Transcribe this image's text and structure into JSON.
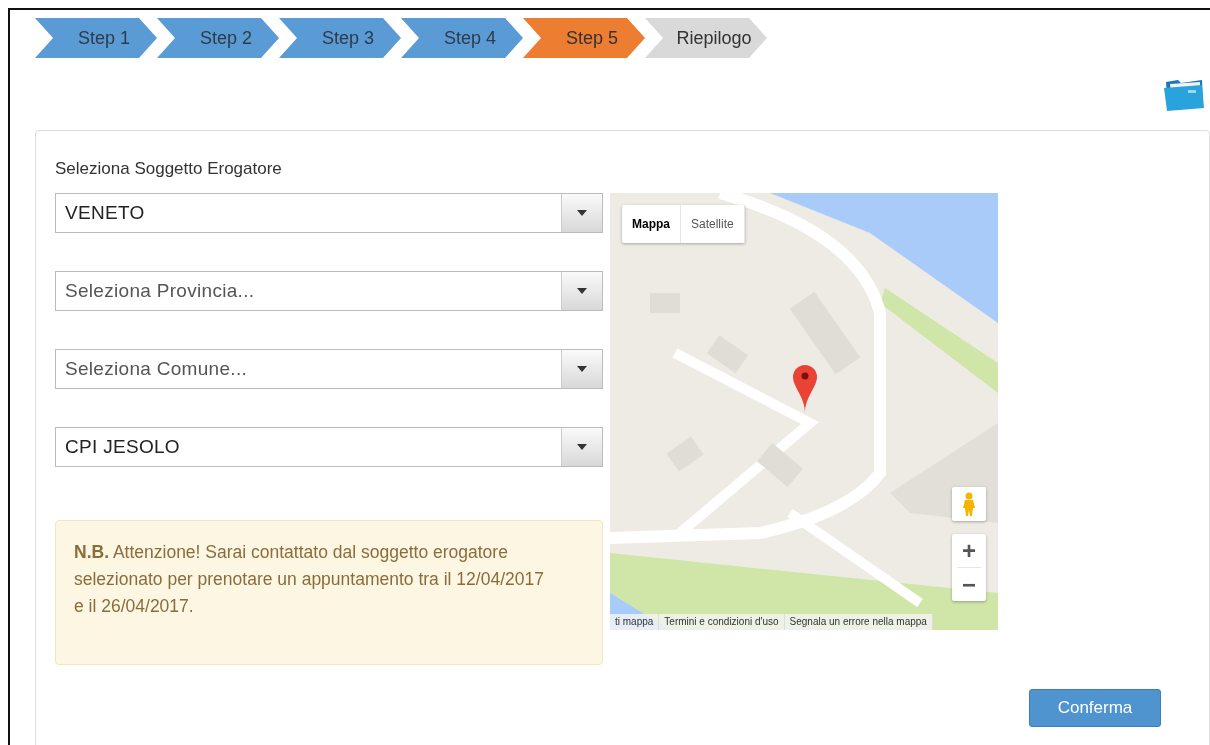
{
  "steps": [
    {
      "label": "Step 1",
      "completed": true,
      "selected": false
    },
    {
      "label": "Step 2",
      "completed": true,
      "selected": false
    },
    {
      "label": "Step 3",
      "completed": true,
      "selected": false
    },
    {
      "label": "Step 4",
      "completed": true,
      "selected": false
    },
    {
      "label": "Step 5",
      "completed": false,
      "selected": true
    },
    {
      "label": "Riepilogo",
      "completed": false,
      "selected": false
    }
  ],
  "form": {
    "title": "Seleziona Soggetto Erogatore",
    "selects": [
      {
        "value": "VENETO"
      },
      {
        "placeholder": "Seleziona Provincia..."
      },
      {
        "placeholder": "Seleziona Comune..."
      },
      {
        "value": "CPI JESOLO"
      }
    ],
    "note": "**N.B.** Attenzione! Sarai contattato dal soggetto erogatore selezionato per prenotare un appuntamento tra il 12/04/2017 e il 26/04/2017."
  },
  "map": {
    "kind": "picture",
    "map_types": [
      {
        "label": "Mappa",
        "selected": true
      },
      {
        "label": "Satellite",
        "selected": false
      }
    ],
    "zoom_in": "+",
    "zoom_out": "−",
    "footer": [
      "ti mappa",
      "Termini e condizioni d'uso",
      "Segnala un errore nella mappa"
    ]
  },
  "confirm_button": "Conferma"
}
